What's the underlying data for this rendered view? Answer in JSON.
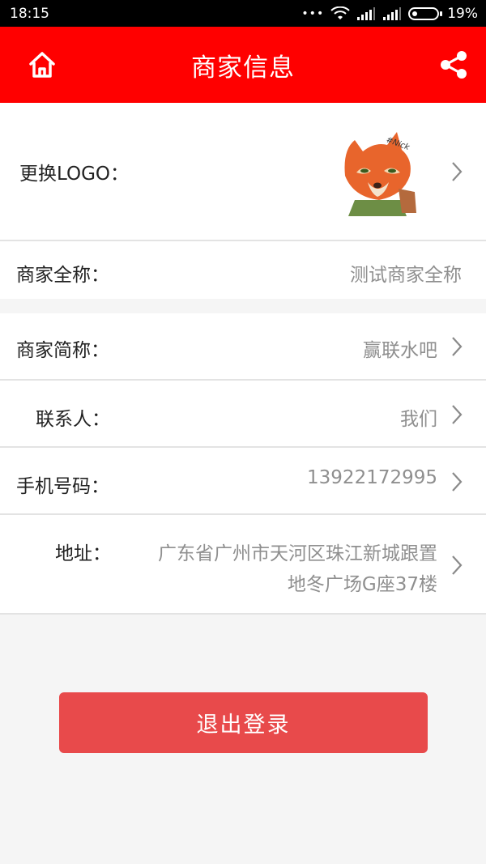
{
  "status_bar": {
    "time": "18:15",
    "signal_dots": "•••",
    "battery_percent": "19%",
    "battery_level": 0.19
  },
  "header": {
    "title": "商家信息",
    "home_icon": "home-icon",
    "share_icon": "share-icon",
    "bg_color": "#ff0000"
  },
  "form": {
    "logo_label": "更换LOGO：",
    "fullname_label": "商家全称：",
    "fullname_value": "测试商家全称",
    "shortname_label": "商家简称：",
    "shortname_value": "赢联水吧",
    "contact_label": "联系人：",
    "contact_value": "我们",
    "phone_label": "手机号码：",
    "phone_value": "13922172995",
    "address_label": "地址：",
    "address_line1": "广东省广州市天河区珠江新城跟置",
    "address_line2": "地冬广场G座37楼"
  },
  "logout": {
    "label": "退出登录",
    "color": "#e84a4b"
  }
}
